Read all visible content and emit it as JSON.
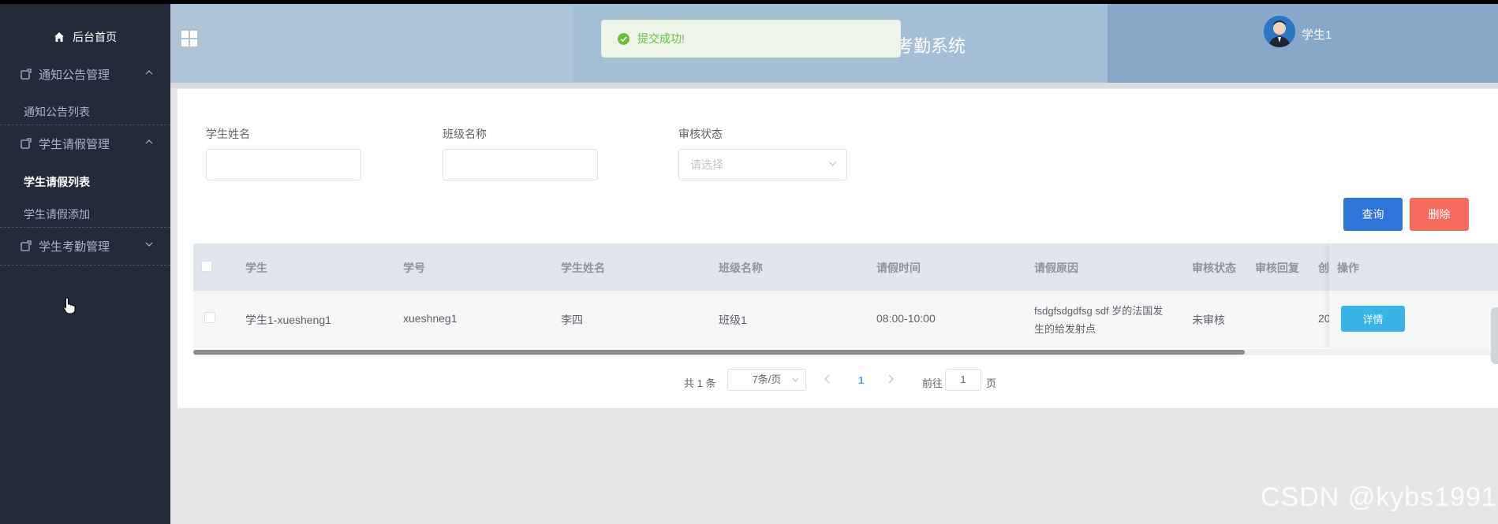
{
  "sidebar": {
    "home": "后台首页",
    "groups": [
      {
        "label": "通知公告管理",
        "items": [
          "通知公告列表"
        ]
      },
      {
        "label": "学生请假管理",
        "items": [
          "学生请假列表",
          "学生请假添加"
        ]
      },
      {
        "label": "学生考勤管理",
        "items": []
      }
    ]
  },
  "header": {
    "system_title": "考勤系统",
    "user_name": "学生1"
  },
  "toast": {
    "message": "提交成功!"
  },
  "filters": {
    "student_name_label": "学生姓名",
    "class_name_label": "班级名称",
    "status_label": "审核状态",
    "status_placeholder": "请选择"
  },
  "buttons": {
    "query": "查询",
    "delete": "删除"
  },
  "table": {
    "columns": [
      "学生",
      "学号",
      "学生姓名",
      "班级名称",
      "请假时间",
      "请假原因",
      "审核状态",
      "审核回复",
      "创",
      "操作"
    ],
    "rows": [
      {
        "student": "学生1-xuesheng1",
        "student_no": "xueshneg1",
        "student_name": "李四",
        "class_name": "班级1",
        "leave_time": "08:00-10:00",
        "reason_line1": "fsdgfsdgdfsg sdf 岁的法国发",
        "reason_line2": "生的给发射点",
        "status": "未审核",
        "reply": "",
        "created": "20",
        "action": "详情"
      }
    ]
  },
  "pagination": {
    "total": "共 1 条",
    "page_size": "7条/页",
    "current": "1",
    "goto_label": "前往",
    "goto_value": "1",
    "page_suffix": "页"
  },
  "watermark": "CSDN @kybs1991",
  "colors": {
    "sidebar_bg": "#232a3a",
    "primary": "#2f74d8",
    "danger": "#f56c5f",
    "success": "#67c23a",
    "info": "#39b4e6"
  }
}
